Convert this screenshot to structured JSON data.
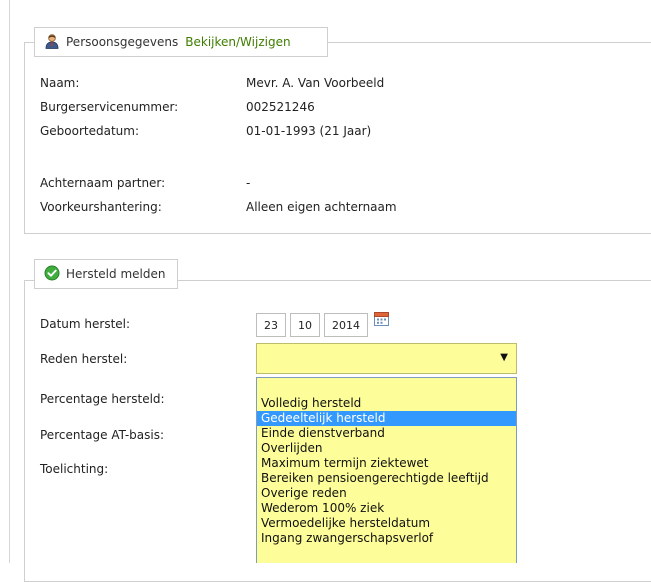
{
  "persoon": {
    "legend_title": "Persoonsgegevens",
    "legend_link": "Bekijken/Wijzigen",
    "fields": [
      {
        "label": "Naam:",
        "value": "Mevr. A. Van Voorbeeld"
      },
      {
        "label": "Burgerservicenummer:",
        "value": "002521246"
      },
      {
        "label": "Geboortedatum:",
        "value": "01-01-1993 (21 Jaar)"
      },
      {
        "label": "Achternaam partner:",
        "value": "-"
      },
      {
        "label": "Voorkeurshantering:",
        "value": "Alleen eigen achternaam"
      }
    ]
  },
  "hersteld": {
    "legend_title": "Hersteld melden",
    "datum_label": "Datum herstel:",
    "datum_day": "23",
    "datum_month": "10",
    "datum_year": "2014",
    "reden_label": "Reden herstel:",
    "percentage_label": "Percentage hersteld:",
    "at_label": "Percentage AT-basis:",
    "toelichting_label": "Toelichting:",
    "reden_value": "",
    "reden_options": [
      "Volledig hersteld",
      "Gedeeltelijk hersteld",
      "Einde dienstverband",
      "Overlijden",
      "Maximum termijn ziektewet",
      "Bereiken pensioengerechtigde leeftijd",
      "Overige reden",
      "Wederom 100% ziek",
      "Vermoedelijke hersteldatum",
      "Ingang zwangerschapsverlof"
    ],
    "highlighted_option": "Gedeeltelijk hersteld"
  },
  "colors": {
    "link": "#3f7d00",
    "field_bg": "#fdfd9a",
    "highlight": "#3399ff"
  }
}
